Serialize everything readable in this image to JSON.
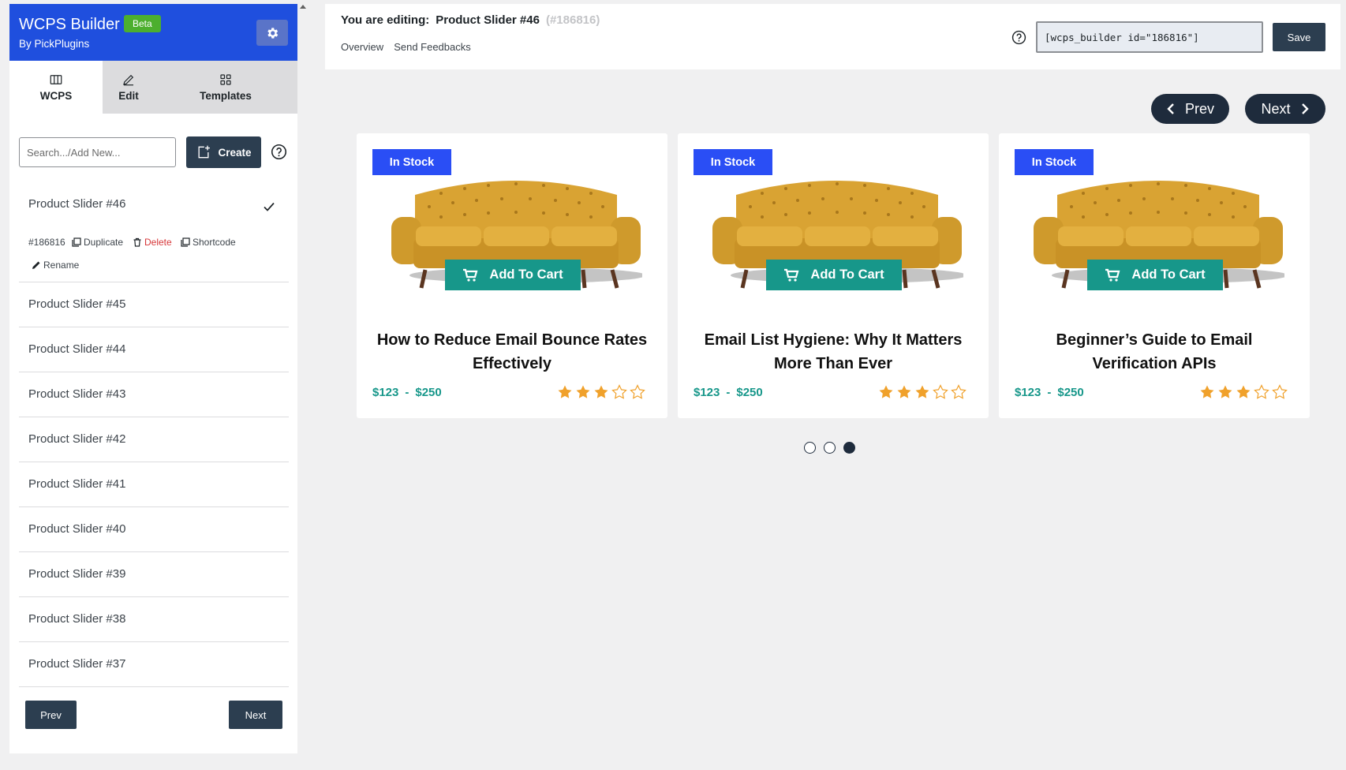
{
  "app": {
    "title": "WCPS Builder",
    "badge": "Beta",
    "byline": "By PickPlugins",
    "colors": {
      "brand": "#1f4fde",
      "dark": "#2c3e50",
      "accent": "#17978a",
      "badge": "#2a4ef5",
      "star": "#f0a12b"
    }
  },
  "tabs": [
    {
      "label": "WCPS",
      "icon": "columns-icon"
    },
    {
      "label": "Edit",
      "icon": "pencil-icon"
    },
    {
      "label": "Templates",
      "icon": "grid-icon"
    }
  ],
  "search": {
    "placeholder": "Search.../Add New...",
    "value": ""
  },
  "create_label": "Create",
  "active_item": {
    "label": "Product Slider #46",
    "id": "#186816",
    "actions": {
      "duplicate": "Duplicate",
      "delete": "Delete",
      "shortcode": "Shortcode",
      "rename": "Rename"
    }
  },
  "list_items": [
    "Product Slider #45",
    "Product Slider #44",
    "Product Slider #43",
    "Product Slider #42",
    "Product Slider #41",
    "Product Slider #40",
    "Product Slider #39",
    "Product Slider #38",
    "Product Slider #37"
  ],
  "left_pager": {
    "prev": "Prev",
    "next": "Next"
  },
  "header": {
    "editing_prefix": "You are editing:",
    "editing_name": "Product Slider #46",
    "editing_id": "(#186816)",
    "links": [
      "Overview",
      "Send Feedbacks"
    ],
    "shortcode": "[wcps_builder id=\"186816\"]",
    "save_label": "Save"
  },
  "slider": {
    "prev": "Prev",
    "next": "Next",
    "pages": 3,
    "active_page": 3
  },
  "cards": [
    {
      "badge": "In Stock",
      "cart": "Add To Cart",
      "title": "How to Reduce Email Bounce Rates Effectively",
      "price_min": "$123",
      "price_max": "$250",
      "price_sep": "-",
      "rating": 3,
      "rating_max": 5
    },
    {
      "badge": "In Stock",
      "cart": "Add To Cart",
      "title": "Email List Hygiene: Why It Matters More Than Ever",
      "price_min": "$123",
      "price_max": "$250",
      "price_sep": "-",
      "rating": 3,
      "rating_max": 5
    },
    {
      "badge": "In Stock",
      "cart": "Add To Cart",
      "title": "Beginner’s Guide to Email Verification APIs",
      "price_min": "$123",
      "price_max": "$250",
      "price_sep": "-",
      "rating": 3,
      "rating_max": 5
    }
  ]
}
